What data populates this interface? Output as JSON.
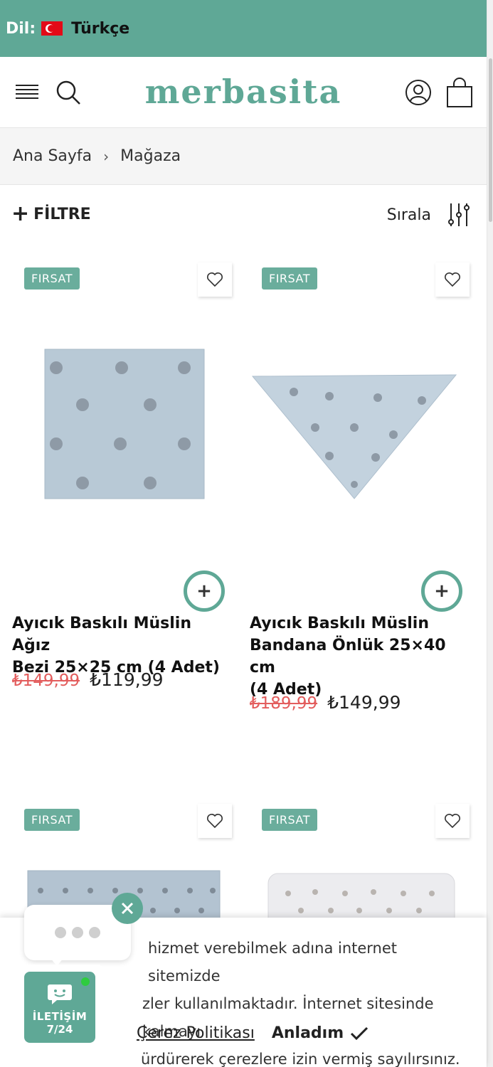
{
  "lang_bar": {
    "label": "Dil:",
    "language": "Türkçe"
  },
  "header": {
    "logo": "merbasita"
  },
  "breadcrumb": {
    "items": [
      "Ana Sayfa",
      "Mağaza"
    ],
    "separator": "›"
  },
  "filter": {
    "filter_label": "FİLTRE",
    "sort_label": "Sırala"
  },
  "products": [
    {
      "badge": "FIRSAT",
      "name_lines": [
        "Ayıcık Baskılı Müslin Ağız",
        "Bezi 25×25 cm (4 Adet)"
      ],
      "old_price": "₺149,99",
      "new_price": "₺119,99"
    },
    {
      "badge": "FIRSAT",
      "name_lines": [
        "Ayıcık Baskılı Müslin",
        "Bandana Önlük 25×40 cm",
        "(4 Adet)"
      ],
      "old_price": "₺189,99",
      "new_price": "₺149,99"
    },
    {
      "badge": "FIRSAT"
    },
    {
      "badge": "FIRSAT"
    }
  ],
  "cookie": {
    "lines": [
      "hizmet verebilmek adına internet sitemizde",
      "zler kullanılmaktadır. İnternet sitesinde kalmayı",
      "ürdürerek çerezlere izin vermiş sayılırsınız."
    ],
    "policy_link": "Çerez Politikası",
    "accept_label": "Anladım"
  },
  "chat": {
    "line1": "İLETİŞİM",
    "line2": "7/24"
  },
  "colors": {
    "brand": "#5fa896",
    "sale_price": "#e35d5d"
  }
}
